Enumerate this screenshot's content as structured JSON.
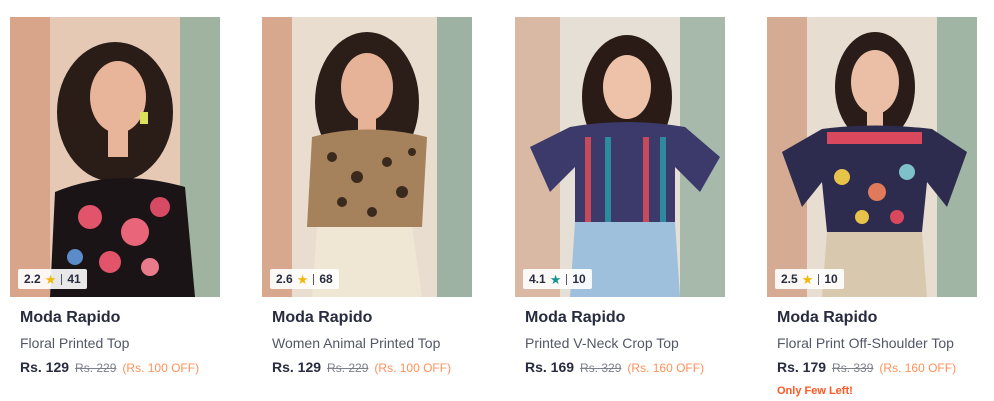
{
  "products": [
    {
      "brand": "Moda Rapido",
      "name": "Floral Printed Top",
      "price": "Rs. 129",
      "mrp": "Rs. 229",
      "discount": "(Rs. 100 OFF)",
      "rating": "2.2",
      "rating_count": "41",
      "star_color": "#f2b807",
      "urgency": ""
    },
    {
      "brand": "Moda Rapido",
      "name": "Women Animal Printed Top",
      "price": "Rs. 129",
      "mrp": "Rs. 229",
      "discount": "(Rs. 100 OFF)",
      "rating": "2.6",
      "rating_count": "68",
      "star_color": "#f2b807",
      "urgency": ""
    },
    {
      "brand": "Moda Rapido",
      "name": "Printed V-Neck Crop Top",
      "price": "Rs. 169",
      "mrp": "Rs. 329",
      "discount": "(Rs. 160 OFF)",
      "rating": "4.1",
      "rating_count": "10",
      "star_color": "#14958f",
      "urgency": ""
    },
    {
      "brand": "Moda Rapido",
      "name": "Floral Print Off-Shoulder Top",
      "price": "Rs. 179",
      "mrp": "Rs. 339",
      "discount": "(Rs. 160 OFF)",
      "rating": "2.5",
      "rating_count": "10",
      "star_color": "#f2b807",
      "urgency": "Only Few Left!"
    }
  ],
  "colors": {
    "brand_text": "#282c3f",
    "discount": "#ff905a",
    "urgency": "#ff5722"
  }
}
